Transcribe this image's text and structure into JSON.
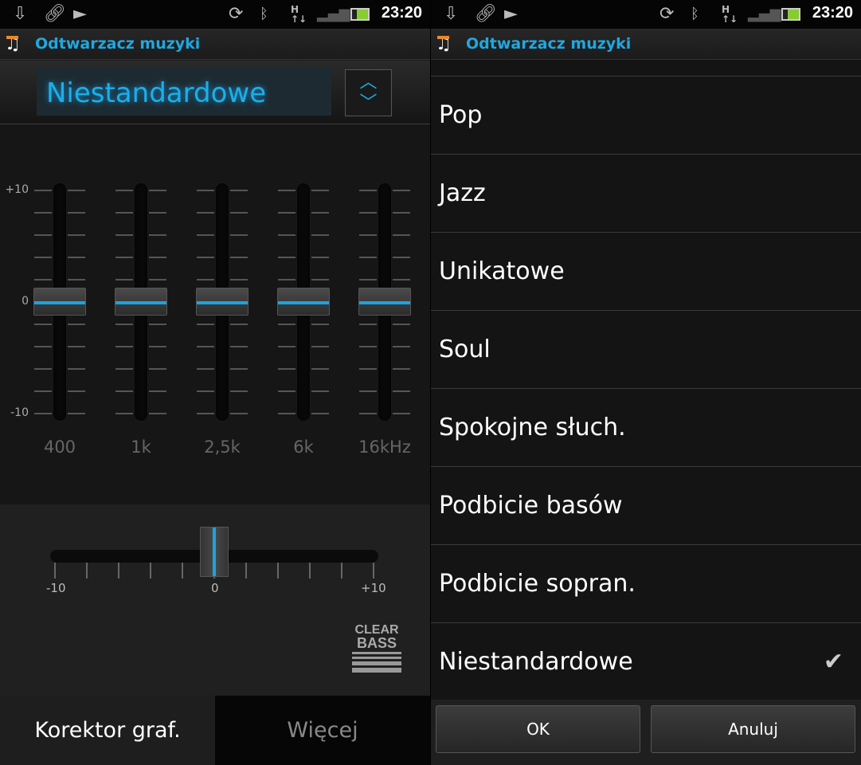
{
  "status_bar": {
    "time": "23:20",
    "icons": [
      "download-icon",
      "link-icon",
      "play-icon",
      "sync-icon",
      "bluetooth-icon",
      "hspa-data-icon",
      "signal-icon",
      "battery-icon"
    ]
  },
  "app": {
    "title": "Odtwarzacz muzyki",
    "icon": "music-note-icon"
  },
  "equalizer": {
    "preset": "Niestandardowe",
    "scale_labels": {
      "max": "+10",
      "mid": "0",
      "min": "-10"
    },
    "range": [
      -10,
      10
    ],
    "bands": [
      {
        "label": "400",
        "value": 0
      },
      {
        "label": "1k",
        "value": 0
      },
      {
        "label": "2,5k",
        "value": 0
      },
      {
        "label": "6k",
        "value": 0
      },
      {
        "label": "16kHz",
        "value": 0
      }
    ]
  },
  "clear_bass": {
    "value": 0,
    "labels": {
      "min": "-10",
      "mid": "0",
      "max": "+10"
    },
    "logo": {
      "line1": "CLEAR",
      "line2": "BASS"
    }
  },
  "tabs": [
    {
      "label": "Korektor graf.",
      "active": true
    },
    {
      "label": "Więcej",
      "active": false
    }
  ],
  "preset_dialog": {
    "items": [
      "Pop",
      "Jazz",
      "Unikatowe",
      "Soul",
      "Spokojne słuch.",
      "Podbicie basów",
      "Podbicie sopran.",
      "Niestandardowe"
    ],
    "selected": "Niestandardowe",
    "ok_label": "OK",
    "cancel_label": "Anuluj"
  },
  "colors": {
    "accent": "#1ab0ea",
    "note": "#e88a2c"
  }
}
